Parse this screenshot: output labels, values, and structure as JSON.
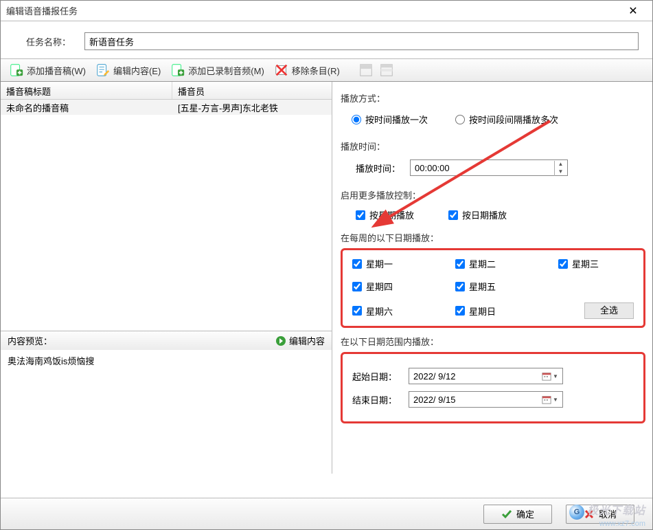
{
  "title": "编辑语音播报任务",
  "task_name_label": "任务名称：",
  "task_name_value": "新语音任务",
  "toolbar": {
    "add_script": "添加播音稿(W)",
    "edit_content": "编辑内容(E)",
    "add_recorded": "添加已录制音频(M)",
    "remove_item": "移除条目(R)"
  },
  "list": {
    "col_title": "播音稿标题",
    "col_anchor": "播音员",
    "rows": [
      {
        "title": "未命名的播音稿",
        "anchor": "[五星-方言-男声]东北老铁"
      }
    ]
  },
  "preview": {
    "header": "内容预览：",
    "edit": "编辑内容",
    "text": "奥法海南鸡饭is烦恼搜"
  },
  "play_method": {
    "label": "播放方式：",
    "opt_once": "按时间播放一次",
    "opt_repeat": "按时间段间隔播放多次",
    "selected": "once"
  },
  "play_time": {
    "label": "播放时间：",
    "field_label": "播放时间：",
    "value": "00:00:00"
  },
  "more_ctrl": {
    "label": "启用更多播放控制：",
    "by_week": "按星期播放",
    "by_date": "按日期播放",
    "by_week_checked": true,
    "by_date_checked": true
  },
  "week": {
    "label": "在每周的以下日期播放：",
    "days": [
      "星期一",
      "星期二",
      "星期三",
      "星期四",
      "星期五",
      "星期六",
      "星期日"
    ],
    "all_checked": true,
    "select_all": "全选"
  },
  "date_range": {
    "label": "在以下日期范围内播放：",
    "start_label": "起始日期：",
    "end_label": "结束日期：",
    "start": "2022/ 9/12",
    "end": "2022/ 9/15"
  },
  "buttons": {
    "ok": "确定",
    "cancel": "取消"
  },
  "watermark": {
    "line1": "极光下载站",
    "line2": "www.xz7.com"
  }
}
